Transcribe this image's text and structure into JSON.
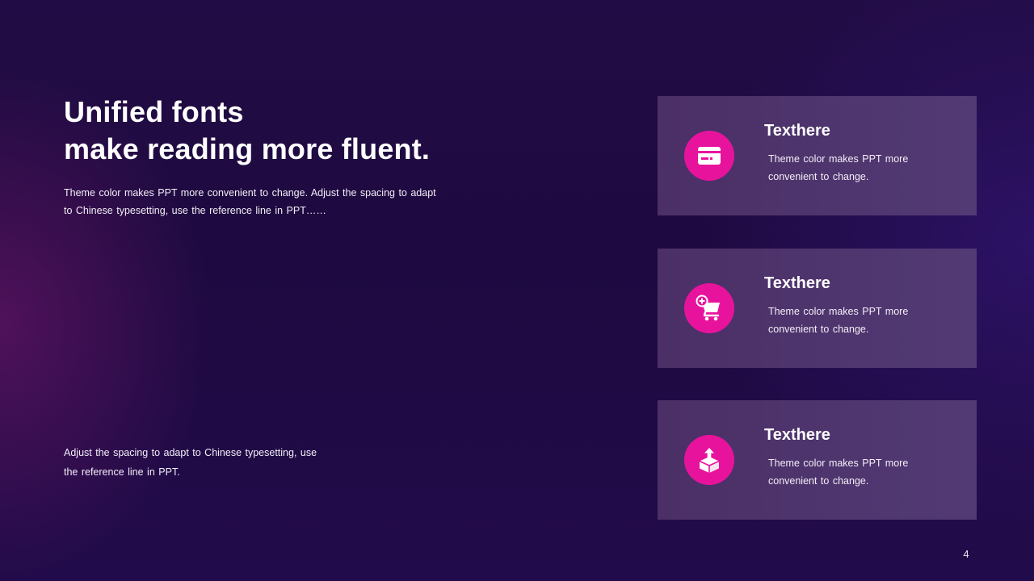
{
  "heading": {
    "line1": "Unified fonts",
    "line2": "make reading more fluent."
  },
  "intro_text": "Theme color makes PPT more convenient  to change. Adjust the spacing to adapt to Chinese  typesetting, use the reference line in PPT……",
  "footnote_text": "Adjust the spacing to adapt to Chinese typesetting, use the reference line in PPT.",
  "cards": [
    {
      "icon": "credit-card-icon",
      "title": "Texthere",
      "text": "Theme color makes PPT more convenient  to change."
    },
    {
      "icon": "shopping-cart-add-icon",
      "title": "Texthere",
      "text": "Theme color makes PPT more convenient  to change."
    },
    {
      "icon": "package-upload-icon",
      "title": "Texthere",
      "text": "Theme color makes PPT more convenient  to change."
    }
  ],
  "page_number": "4",
  "colors": {
    "accent": "#e8139c",
    "background": "#210b44",
    "card": "#4e3470"
  }
}
